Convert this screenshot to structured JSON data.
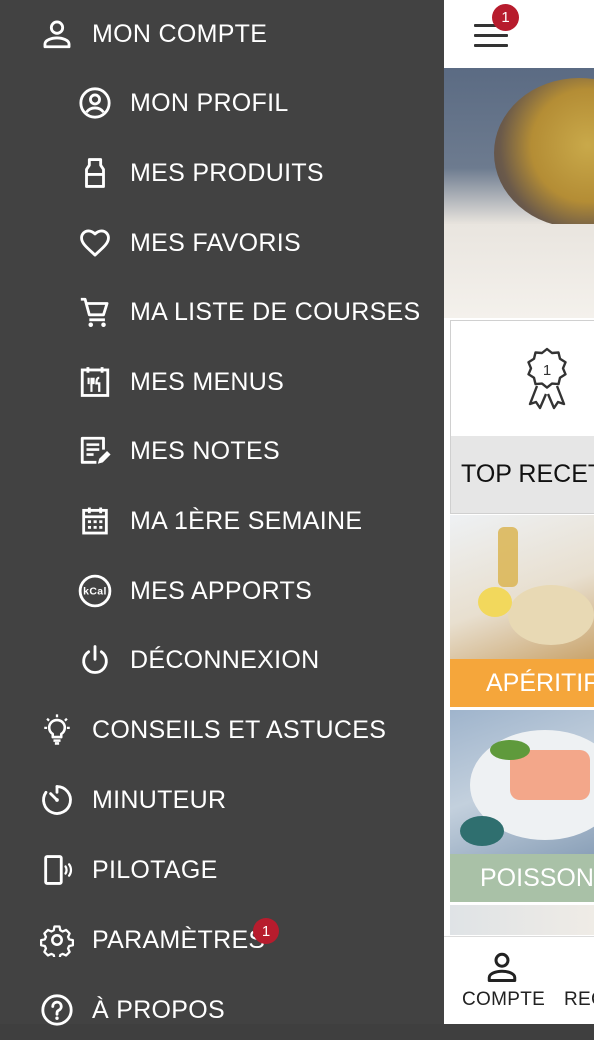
{
  "drawer": {
    "items": [
      {
        "label": "MON COMPTE",
        "icon": "person-icon"
      },
      {
        "label": "MON PROFIL",
        "icon": "account-circle-icon"
      },
      {
        "label": "MES PRODUITS",
        "icon": "appliance-icon"
      },
      {
        "label": "MES FAVORIS",
        "icon": "heart-icon"
      },
      {
        "label": "MA LISTE DE COURSES",
        "icon": "shopping-cart-icon"
      },
      {
        "label": "MES MENUS",
        "icon": "menu-calendar-icon"
      },
      {
        "label": "MES NOTES",
        "icon": "notes-edit-icon"
      },
      {
        "label": "MA 1ÈRE SEMAINE",
        "icon": "calendar-icon"
      },
      {
        "label": "MES APPORTS",
        "icon": "kcal-icon",
        "icon_text": "kCal"
      },
      {
        "label": "DÉCONNEXION",
        "icon": "power-icon"
      },
      {
        "label": "CONSEILS ET ASTUCES",
        "icon": "lightbulb-icon"
      },
      {
        "label": "MINUTEUR",
        "icon": "timer-icon"
      },
      {
        "label": "PILOTAGE",
        "icon": "phone-remote-icon"
      },
      {
        "label": "PARAMÈTRES",
        "icon": "gear-icon",
        "badge": "1"
      },
      {
        "label": "À PROPOS",
        "icon": "help-circle-icon"
      }
    ]
  },
  "app": {
    "menu_badge": "1",
    "medal_number": "1",
    "top_recipes_label": "TOP RECETT",
    "categories": [
      {
        "label": "APÉRITIFS",
        "color": "#f5a63b"
      },
      {
        "label": "POISSON",
        "color": "#a9c1a7"
      }
    ],
    "bottom_nav": [
      {
        "label": "COMPTE",
        "icon": "person-icon"
      },
      {
        "label": "REC",
        "icon": "recipes-icon"
      }
    ]
  },
  "colors": {
    "drawer_bg": "#424242",
    "badge": "#b71c2d",
    "text_on_drawer": "#ffffff"
  }
}
